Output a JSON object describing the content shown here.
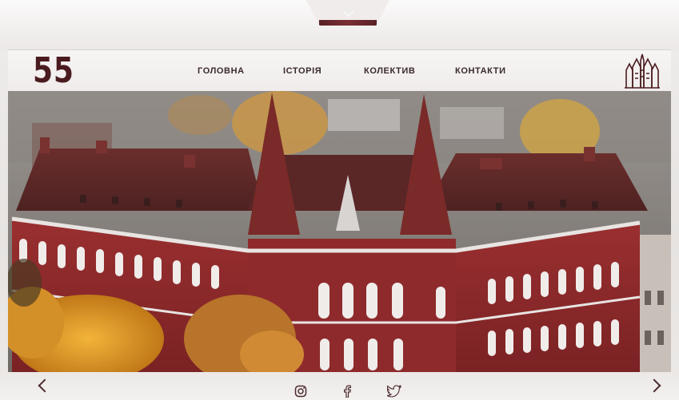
{
  "header": {
    "logo_text": "55",
    "nav": [
      {
        "label": "ГОЛОВНА"
      },
      {
        "label": "ІСТОРІЯ"
      },
      {
        "label": "КОЛЕКТИВ"
      },
      {
        "label": "КОНТАКТИ"
      }
    ],
    "dropdown_icon": "chevron-down-icon",
    "building_icon": "building-icon"
  },
  "hero": {
    "image": "photo of red brick historic school building with spires and autumn trees"
  },
  "footer": {
    "prev_icon": "chevron-left-icon",
    "next_icon": "chevron-right-icon",
    "social": [
      "instagram-icon",
      "facebook-icon",
      "twitter-icon"
    ]
  },
  "colors": {
    "brand": "#4a1b1f",
    "accent": "#7a2e33",
    "brick": "#8b2a2c",
    "roof": "#5e2a2a",
    "trees": "#e0a02a"
  }
}
